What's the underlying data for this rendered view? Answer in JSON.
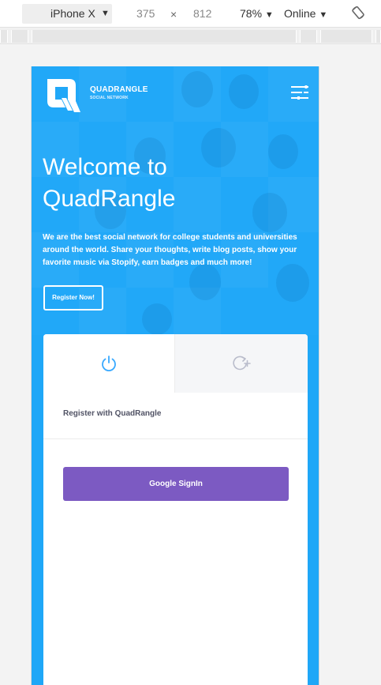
{
  "devtools": {
    "device": "iPhone X",
    "width": "375",
    "times": "×",
    "height": "812",
    "zoom": "78%",
    "network": "Online",
    "caret": "▼"
  },
  "brand": {
    "name": "QUADRANGLE",
    "tagline": "SOCIAL NETWORK"
  },
  "hero": {
    "title_line1": "Welcome to",
    "title_line2": "QuadRangle",
    "text": "We are the best social network for college students and universities around the world. Share your thoughts, write blog posts, show your favorite music via Stopify, earn badges and much more!",
    "cta": "Register Now!"
  },
  "card": {
    "tabs": [
      {
        "icon": "power-icon"
      },
      {
        "icon": "refresh-plus-icon"
      }
    ],
    "heading": "Register with QuadRangle",
    "google_button": "Google SignIn"
  },
  "colors": {
    "primary": "#1fa7f7",
    "button": "#7c5ac2",
    "accent": "#38a9ff"
  }
}
